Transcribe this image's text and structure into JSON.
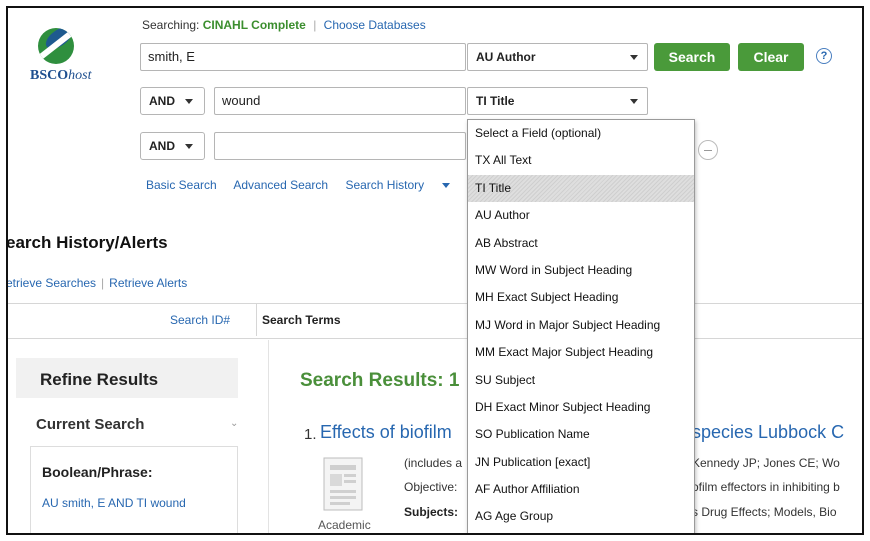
{
  "logo": {
    "brand_bold": "BSCO",
    "brand_italic": "host"
  },
  "searching": {
    "prefix": "Searching:",
    "database": "CINAHL Complete",
    "choose_link": "Choose Databases"
  },
  "rows": [
    {
      "operator": null,
      "term": "smith, E",
      "field": "AU Author"
    },
    {
      "operator": "AND",
      "term": "wound",
      "field": "TI Title"
    },
    {
      "operator": "AND",
      "term": "",
      "field": ""
    }
  ],
  "buttons": {
    "search": "Search",
    "clear": "Clear",
    "help": "?"
  },
  "search_links": {
    "basic": "Basic Search",
    "advanced": "Advanced Search",
    "history": "Search History"
  },
  "history": {
    "title": "earch History/Alerts",
    "retrieve_searches": "etrieve Searches",
    "retrieve_alerts": "Retrieve Alerts"
  },
  "history_table": {
    "col_id": "Search ID#",
    "col_terms": "Search Terms"
  },
  "refine": {
    "title": "Refine Results",
    "current_search": "Current Search",
    "boolean_label": "Boolean/Phrase:",
    "boolean_value": "AU smith, E AND TI wound"
  },
  "results": {
    "title": "Search Results: 1",
    "item_number": "1.",
    "item_title_start": "Effects of biofilm",
    "item_title_end": "species Lubbock C",
    "doc_label": "Academic",
    "meta_left": [
      "(includes a",
      "Objective:",
      "Subjects:"
    ],
    "meta_right": [
      "Kennedy JP; Jones CE; Wo",
      "ofilm effectors in inhibiting b",
      "s Drug Effects; Models, Bio"
    ]
  },
  "dropdown": {
    "selected_index": 2,
    "options": [
      "Select a Field (optional)",
      "TX All Text",
      "TI Title",
      "AU Author",
      "AB Abstract",
      "MW Word in Subject Heading",
      "MH Exact Subject Heading",
      "MJ Word in Major Subject Heading",
      "MM Exact Major Subject Heading",
      "SU Subject",
      "DH Exact Minor Subject Heading",
      "SO Publication Name",
      "JN Publication [exact]",
      "AF Author Affiliation",
      "AG Age Group"
    ]
  },
  "colors": {
    "accent_green": "#4a9a3a",
    "link_blue": "#2767b0",
    "db_green": "#3b8e2e"
  }
}
